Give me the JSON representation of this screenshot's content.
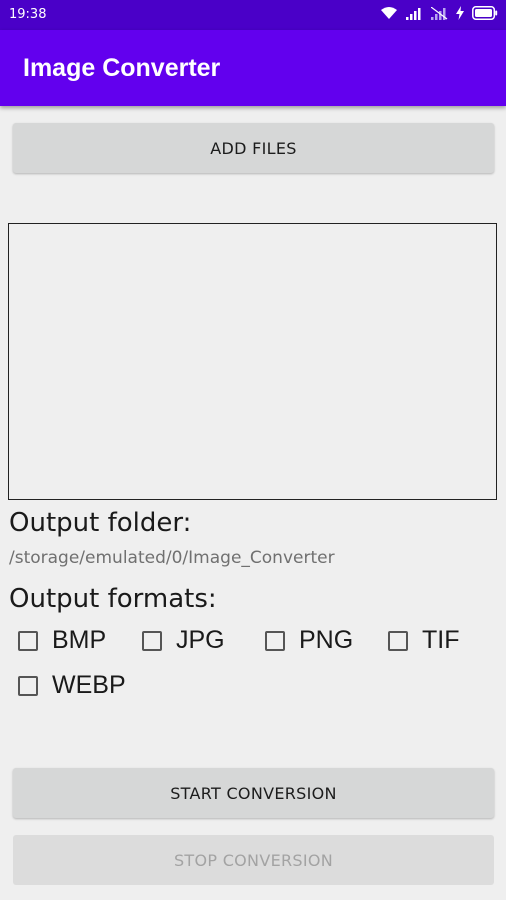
{
  "status_bar": {
    "time": "19:38"
  },
  "app_bar": {
    "title": "Image Converter"
  },
  "buttons": {
    "add_files": "ADD FILES",
    "start_conversion": "START CONVERSION",
    "stop_conversion": "STOP CONVERSION"
  },
  "output_folder": {
    "label": "Output folder:",
    "path": "/storage/emulated/0/Image_Converter"
  },
  "output_formats": {
    "label": "Output formats:",
    "options": [
      {
        "label": "BMP",
        "checked": false
      },
      {
        "label": "JPG",
        "checked": false
      },
      {
        "label": "PNG",
        "checked": false
      },
      {
        "label": "TIF",
        "checked": false
      },
      {
        "label": "WEBP",
        "checked": false
      }
    ]
  },
  "colors": {
    "status_bar": "#4a00c8",
    "app_bar": "#6200ee",
    "button": "#d6d7d7",
    "background": "#efefef"
  }
}
